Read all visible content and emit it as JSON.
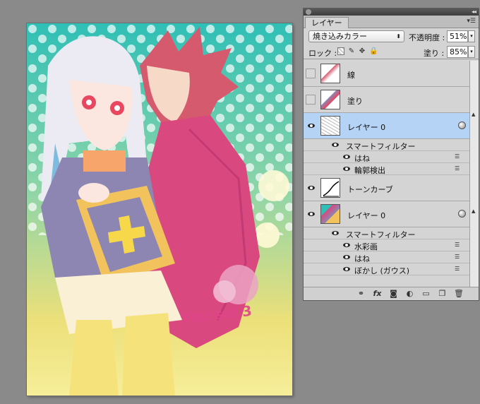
{
  "canvas": {
    "signature": "You sol 3"
  },
  "panel": {
    "tab_label": "レイヤー",
    "blend_mode": "焼き込みカラー",
    "opacity_label": "不透明度 :",
    "opacity_value": "51%",
    "lock_label": "ロック :",
    "fill_label": "塗り :",
    "fill_value": "85%"
  },
  "layers": [
    {
      "name": "線",
      "visible": false
    },
    {
      "name": "塗り",
      "visible": false
    },
    {
      "name": "レイヤー 0",
      "visible": true,
      "selected": true,
      "smart_filters_label": "スマートフィルター",
      "filters": [
        "はね",
        "輪郭検出"
      ]
    },
    {
      "name": "トーンカーブ",
      "visible": true
    },
    {
      "name": "レイヤー 0",
      "visible": true,
      "smart_filters_label": "スマートフィルター",
      "filters": [
        "水彩画",
        "はね",
        "ぼかし (ガウス)"
      ]
    }
  ],
  "icons": [
    "link-icon",
    "fx-icon",
    "mask-icon",
    "adjustment-icon",
    "group-folder-icon",
    "new-layer-icon",
    "trash-icon"
  ],
  "colors": {
    "selection": "#b5d3f5",
    "panel": "#d4d4d4",
    "background": "#8a8a8a"
  }
}
